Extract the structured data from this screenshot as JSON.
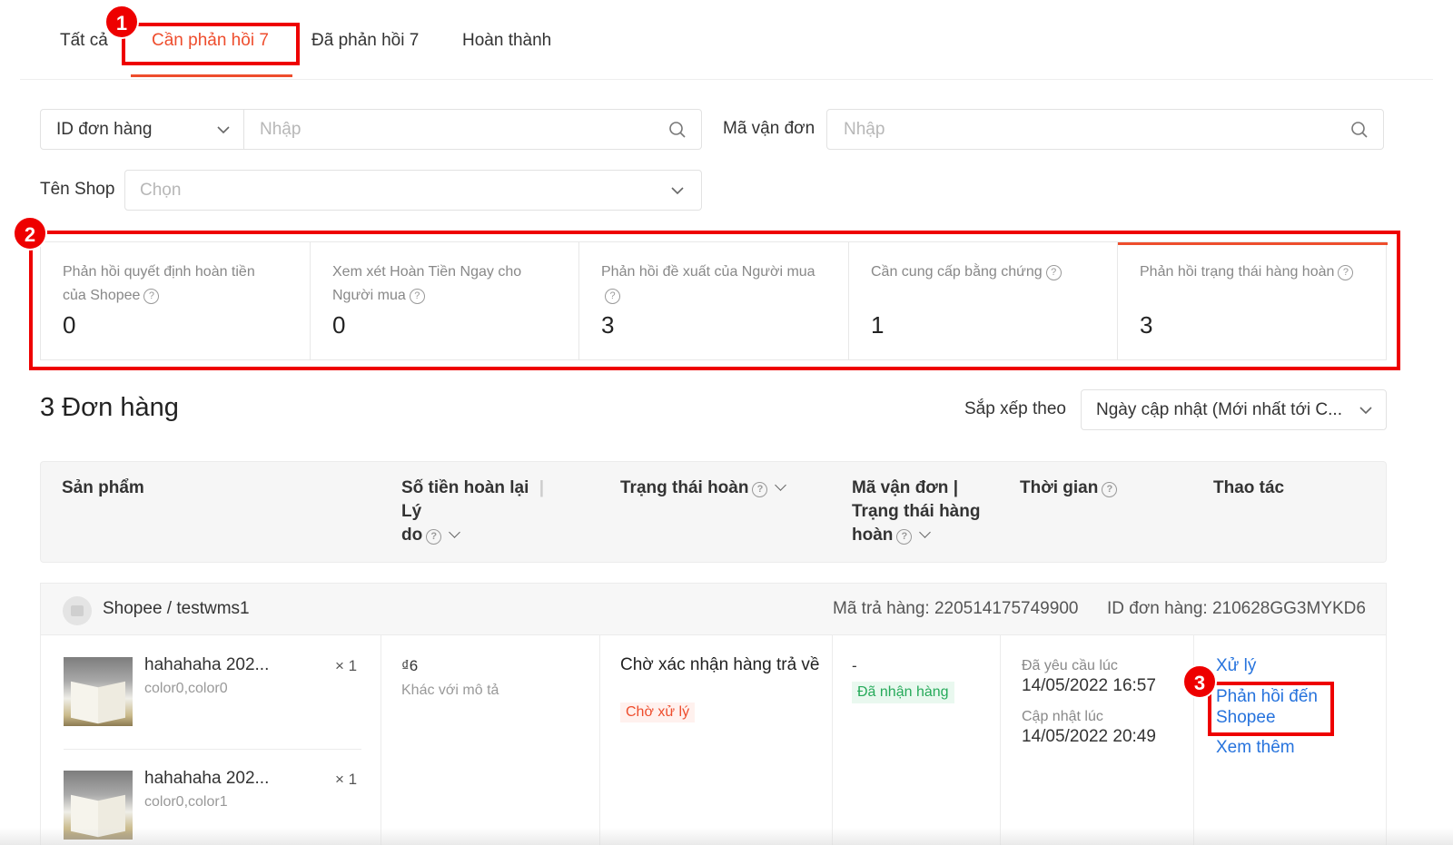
{
  "tabs": [
    {
      "label": "Tất cả"
    },
    {
      "label": "Cần phản hồi 7"
    },
    {
      "label": "Đã phản hồi 7"
    },
    {
      "label": "Hoàn thành"
    }
  ],
  "annotations": [
    "1",
    "2",
    "3"
  ],
  "filters": {
    "order_id_select": "ID đơn hàng",
    "order_id_placeholder": "Nhập",
    "tracking_label": "Mã vận đơn",
    "tracking_placeholder": "Nhập",
    "shop_label": "Tên Shop",
    "shop_placeholder": "Chọn"
  },
  "stats": [
    {
      "title": "Phản hồi quyết định hoàn tiền của Shopee",
      "value": "0"
    },
    {
      "title": "Xem xét Hoàn Tiền Ngay cho Người mua",
      "value": "0"
    },
    {
      "title": "Phản hồi đề xuất của Người mua",
      "value": "3"
    },
    {
      "title": "Cần cung cấp bằng chứng",
      "value": "1"
    },
    {
      "title": "Phản hồi trạng thái hàng hoàn",
      "value": "3"
    }
  ],
  "orders": {
    "count_title": "3 Đơn hàng",
    "sort_label": "Sắp xếp theo",
    "sort_value": "Ngày cập nhật (Mới nhất tới C..."
  },
  "table": {
    "headers": {
      "product": "Sản phẩm",
      "refund_amount": "Số tiền hoàn lại",
      "reason": "Lý",
      "reason_cont": "do",
      "refund_status": "Trạng thái hoàn",
      "tracking_1": "Mã vận đơn |",
      "tracking_2": "Trạng thái hàng",
      "tracking_3": "hoàn",
      "time": "Thời gian",
      "actions": "Thao tác"
    }
  },
  "order": {
    "shop": "Shopee / testwms1",
    "return_id": "Mã trả hàng: 220514175749900",
    "order_id": "ID đơn hàng: 210628GG3MYKD6",
    "products": [
      {
        "name": "hahahaha 202...",
        "variant": "color0,color0",
        "qty": "× 1"
      },
      {
        "name": "hahahaha 202...",
        "variant": "color0,color1",
        "qty": "× 1"
      }
    ],
    "amount": "₫6",
    "reason": "Khác với mô tả",
    "status": "Chờ xác nhận hàng trả về",
    "status_badge": "Chờ xử lý",
    "tracking": "-",
    "return_goods_status": "Đã nhận hàng",
    "requested_label": "Đã yêu cầu lúc",
    "requested_time": "14/05/2022 16:57",
    "updated_label": "Cập nhật lúc",
    "updated_time": "14/05/2022 20:49",
    "actions": {
      "process": "Xử lý",
      "respond_1": "Phản hồi đến",
      "respond_2": "Shopee",
      "more": "Xem thêm"
    }
  },
  "colors": {
    "accent": "#ee4d2d",
    "annotation": "#ee0000",
    "link": "#2673dd",
    "success": "#26aa5a"
  }
}
